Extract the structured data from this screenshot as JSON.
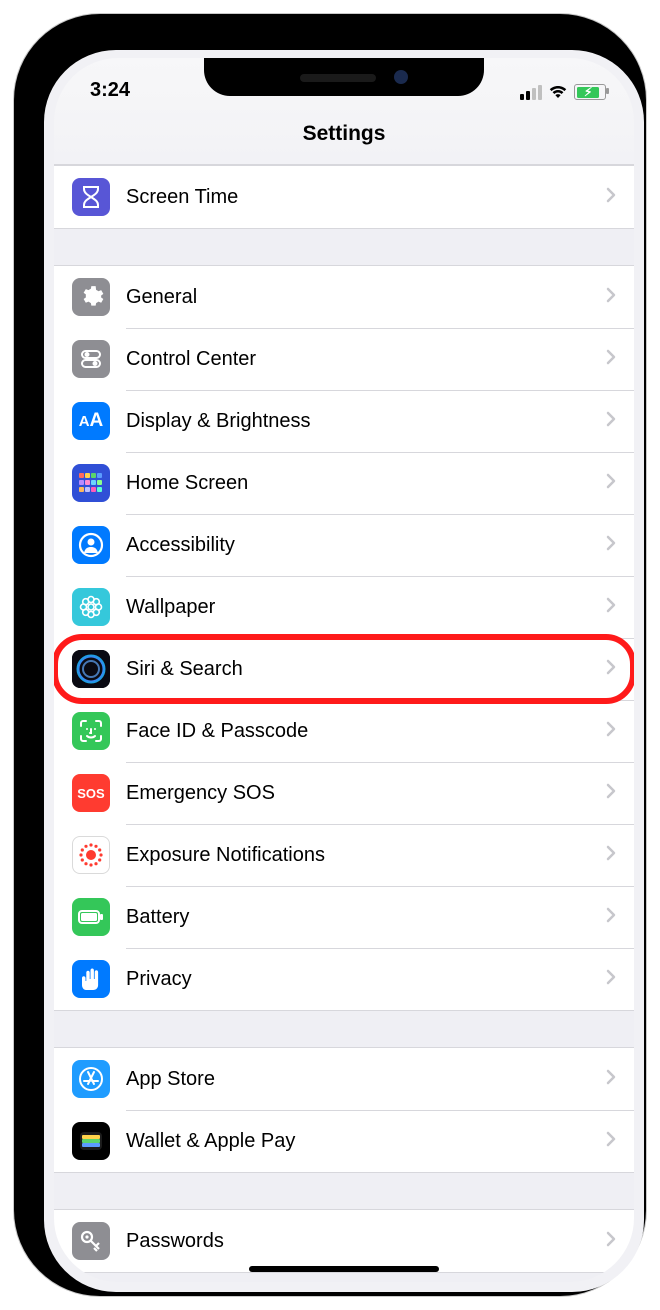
{
  "status": {
    "time": "3:24"
  },
  "nav": {
    "title": "Settings"
  },
  "highlightedKey": "siri-search",
  "sections": [
    {
      "rows": [
        {
          "key": "screentime",
          "label": "Screen Time",
          "iconBg": "#5856d6",
          "icon": "hourglass"
        }
      ]
    },
    {
      "rows": [
        {
          "key": "general",
          "label": "General",
          "iconBg": "#8e8e93",
          "icon": "gear"
        },
        {
          "key": "control-center",
          "label": "Control Center",
          "iconBg": "#8e8e93",
          "icon": "switches"
        },
        {
          "key": "display",
          "label": "Display & Brightness",
          "iconBg": "#007aff",
          "icon": "AA"
        },
        {
          "key": "home-screen",
          "label": "Home Screen",
          "iconBg": "#304fd6",
          "icon": "grid"
        },
        {
          "key": "accessibility",
          "label": "Accessibility",
          "iconBg": "#007aff",
          "icon": "person-circle"
        },
        {
          "key": "wallpaper",
          "label": "Wallpaper",
          "iconBg": "#35c8db",
          "icon": "flower"
        },
        {
          "key": "siri-search",
          "label": "Siri & Search",
          "iconBg": "#000000",
          "icon": "siri"
        },
        {
          "key": "face-id",
          "label": "Face ID & Passcode",
          "iconBg": "#34c759",
          "icon": "faceid"
        },
        {
          "key": "emergency-sos",
          "label": "Emergency SOS",
          "iconBg": "#ff3b30",
          "icon": "SOS"
        },
        {
          "key": "exposure",
          "label": "Exposure Notifications",
          "iconBg": "#ffffff",
          "icon": "exposure",
          "iconFg": "#ff3b30",
          "border": "#dadada"
        },
        {
          "key": "battery",
          "label": "Battery",
          "iconBg": "#34c759",
          "icon": "battery"
        },
        {
          "key": "privacy",
          "label": "Privacy",
          "iconBg": "#007aff",
          "icon": "hand"
        }
      ]
    },
    {
      "rows": [
        {
          "key": "app-store",
          "label": "App Store",
          "iconBg": "#1f9cff",
          "icon": "appstore"
        },
        {
          "key": "wallet",
          "label": "Wallet & Apple Pay",
          "iconBg": "#000000",
          "icon": "wallet"
        }
      ]
    },
    {
      "rows": [
        {
          "key": "passwords",
          "label": "Passwords",
          "iconBg": "#8e8e93",
          "icon": "key"
        }
      ]
    }
  ]
}
